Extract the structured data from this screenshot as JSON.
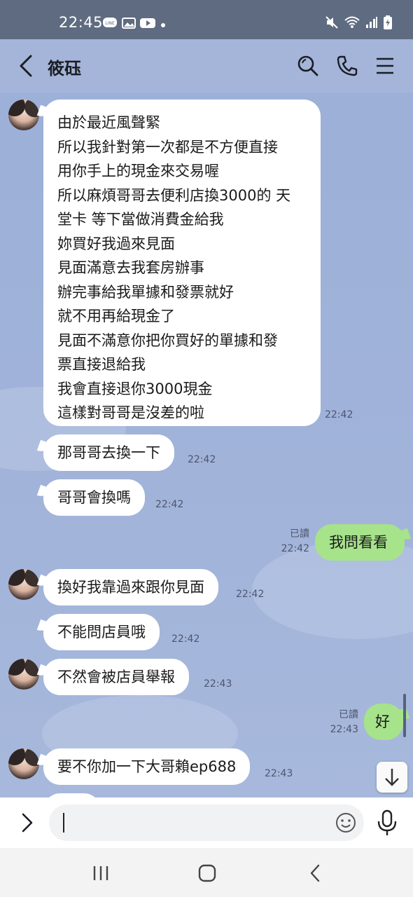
{
  "status_bar": {
    "time": "22:45",
    "left_icons": [
      "line-notification-icon",
      "image-icon",
      "youtube-icon",
      "dot-icon"
    ],
    "right_icons": [
      "mute-icon",
      "wifi-icon",
      "signal-icon",
      "battery-icon"
    ]
  },
  "header": {
    "contact_name": "筱砡",
    "icons": [
      "back-icon",
      "search-icon",
      "phone-icon",
      "menu-icon"
    ]
  },
  "messages": [
    {
      "sender": "contact",
      "lines": [
        "由於最近風聲緊",
        "所以我針對第一次都是不方便直接",
        "用你手上的現金來交易喔",
        "所以麻煩哥哥去便利店換3000的 天",
        "堂卡 等下當做消費金給我",
        "妳買好我過來見面",
        "見面滿意去我套房辦事",
        "辦完事給我單據和發票就好",
        "就不用再給現金了",
        "見面不滿意你把你買好的單據和發",
        "票直接退給我",
        "我會直接退你3000現金",
        "這樣對哥哥是沒差的啦"
      ],
      "time": "22:42"
    },
    {
      "sender": "contact",
      "lines": [
        "那哥哥去換一下"
      ],
      "time": "22:42"
    },
    {
      "sender": "contact",
      "lines": [
        "哥哥會換嗎"
      ],
      "time": "22:42"
    },
    {
      "sender": "me",
      "lines": [
        "我問看看"
      ],
      "read_label": "已讀",
      "time": "22:42"
    },
    {
      "sender": "contact",
      "lines": [
        "換好我靠過來跟你見面"
      ],
      "time": "22:42"
    },
    {
      "sender": "contact",
      "lines": [
        "不能問店員哦"
      ],
      "time": "22:42"
    },
    {
      "sender": "contact",
      "lines": [
        "不然會被店員舉報"
      ],
      "time": "22:43"
    },
    {
      "sender": "me",
      "lines": [
        "好"
      ],
      "read_label": "已讀",
      "time": "22:43"
    },
    {
      "sender": "contact",
      "lines": [
        "要不你加一下大哥賴ep688"
      ],
      "time": "22:43"
    }
  ],
  "input": {
    "value": "",
    "placeholder": ""
  },
  "colors": {
    "chat_bg": "#9db0d6",
    "my_bubble": "#a6e38b",
    "their_bubble": "#ffffff",
    "status_bar": "#5f6b80"
  }
}
